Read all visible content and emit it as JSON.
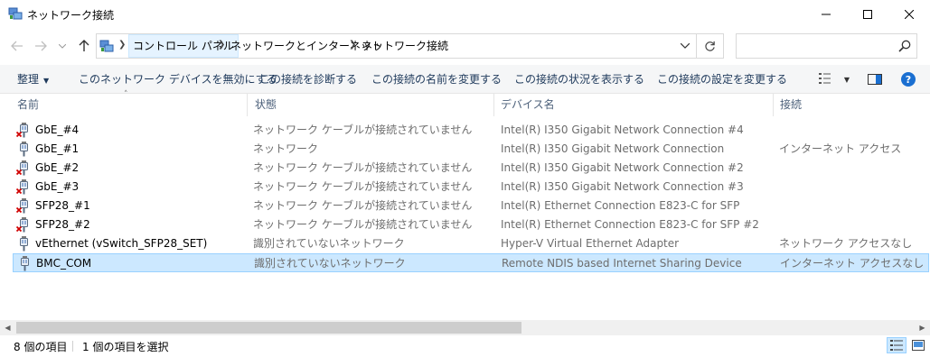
{
  "window": {
    "title": "ネットワーク接続",
    "icon": "network-connections-icon"
  },
  "address_bar": {
    "breadcrumbs": [
      "コントロール パネル",
      "ネットワークとインターネット",
      "ネットワーク接続"
    ],
    "search_placeholder": ""
  },
  "command_bar": {
    "organize": "整理",
    "items": [
      "このネットワーク デバイスを無効にする",
      "この接続を診断する",
      "この接続の名前を変更する",
      "この接続の状況を表示する",
      "この接続の設定を変更する"
    ]
  },
  "columns": {
    "name": "名前",
    "status": "状態",
    "device": "デバイス名",
    "connectivity": "接続"
  },
  "rows": [
    {
      "name": "GbE_#4",
      "status": "ネットワーク ケーブルが接続されていません",
      "device": "Intel(R) I350 Gigabit Network Connection #4",
      "connectivity": "",
      "state": "disconnected",
      "selected": false
    },
    {
      "name": "GbE_#1",
      "status": "ネットワーク",
      "device": "Intel(R) I350 Gigabit Network Connection",
      "connectivity": "インターネット アクセス",
      "state": "connected",
      "selected": false
    },
    {
      "name": "GbE_#2",
      "status": "ネットワーク ケーブルが接続されていません",
      "device": "Intel(R) I350 Gigabit Network Connection #2",
      "connectivity": "",
      "state": "disconnected",
      "selected": false
    },
    {
      "name": "GbE_#3",
      "status": "ネットワーク ケーブルが接続されていません",
      "device": "Intel(R) I350 Gigabit Network Connection #3",
      "connectivity": "",
      "state": "disconnected",
      "selected": false
    },
    {
      "name": "SFP28_#1",
      "status": "ネットワーク ケーブルが接続されていません",
      "device": "Intel(R) Ethernet Connection E823-C for SFP",
      "connectivity": "",
      "state": "disconnected",
      "selected": false
    },
    {
      "name": "SFP28_#2",
      "status": "ネットワーク ケーブルが接続されていません",
      "device": "Intel(R) Ethernet Connection E823-C for SFP #2",
      "connectivity": "",
      "state": "disconnected",
      "selected": false
    },
    {
      "name": "vEthernet (vSwitch_SFP28_SET)",
      "status": "識別されていないネットワーク",
      "device": "Hyper-V Virtual Ethernet Adapter",
      "connectivity": "ネットワーク アクセスなし",
      "state": "connected",
      "selected": false
    },
    {
      "name": "BMC_COM",
      "status": "識別されていないネットワーク",
      "device": "Remote NDIS based Internet Sharing Device",
      "connectivity": "インターネット アクセスなし",
      "state": "connected",
      "selected": true
    }
  ],
  "status_bar": {
    "item_count": "8 個の項目",
    "selected_count": "1 個の項目を選択"
  },
  "colors": {
    "selection_bg": "#cce8ff",
    "selection_border": "#99d1ff",
    "command_text": "#1e395b",
    "header_text": "#4c607a",
    "disconnected_x": "#d00000",
    "help_blue": "#1a6fd1"
  }
}
